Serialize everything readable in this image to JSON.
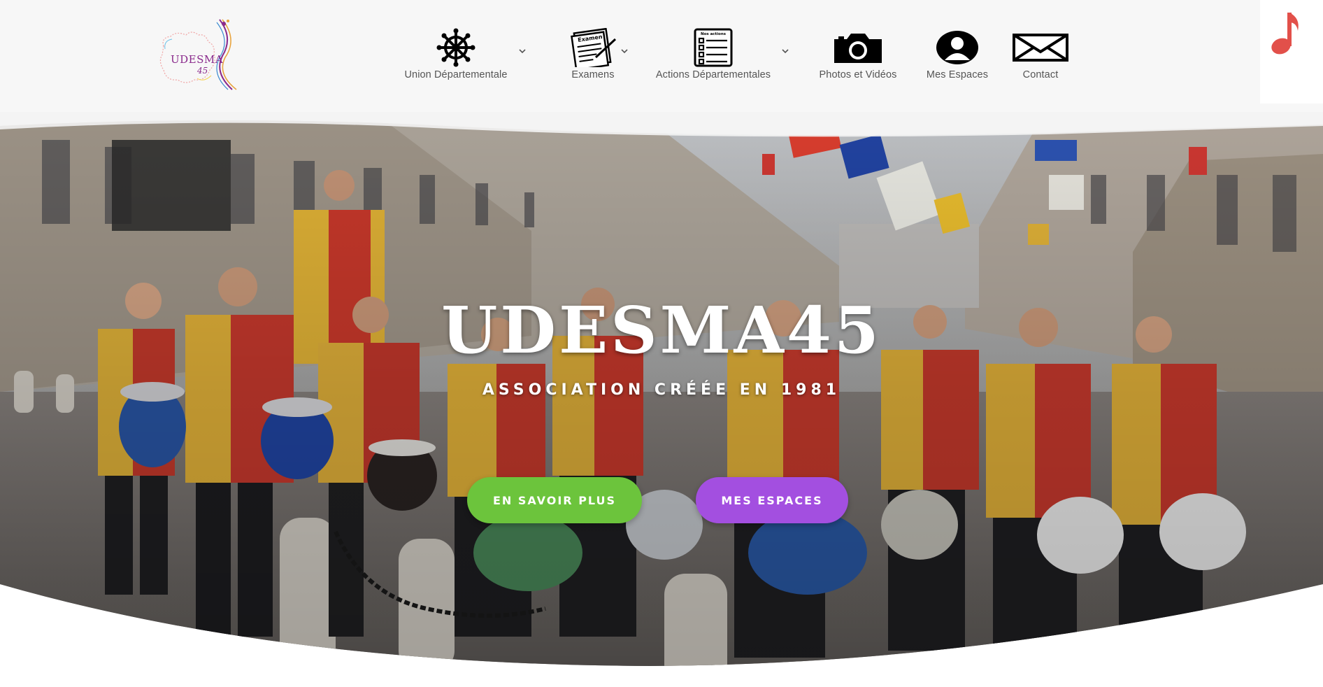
{
  "brand": {
    "logo_text": "UDESMA",
    "logo_sub": "45"
  },
  "nav": [
    {
      "label": "Union Départementale",
      "icon": "ship-wheel-icon",
      "has_dropdown": true
    },
    {
      "label": "Examens",
      "icon": "exam-paper-icon",
      "has_dropdown": true
    },
    {
      "label": "Actions Départementales",
      "icon": "clipboard-checklist-icon",
      "has_dropdown": true
    },
    {
      "label": "Photos et Vidéos",
      "icon": "camera-icon",
      "has_dropdown": false
    },
    {
      "label": "Mes Espaces",
      "icon": "user-avatar-icon",
      "has_dropdown": false
    },
    {
      "label": "Contact",
      "icon": "envelope-icon",
      "has_dropdown": false
    }
  ],
  "icon_texts": {
    "exam": "Examen",
    "actions": "Nos actions"
  },
  "music_toggle": {
    "icon": "music-note-icon"
  },
  "hero": {
    "title": "UDESMA45",
    "subtitle": "ASSOCIATION CRÉÉE EN 1981",
    "primary_button": "EN SAVOIR PLUS",
    "secondary_button": "MES ESPACES"
  },
  "colors": {
    "header_bg": "#f7f7f7",
    "nav_text": "#555555",
    "btn_primary": "#6cc43c",
    "btn_secondary": "#a34fe0",
    "music_note": "#e2504a",
    "logo_text": "#8a2a8c"
  }
}
